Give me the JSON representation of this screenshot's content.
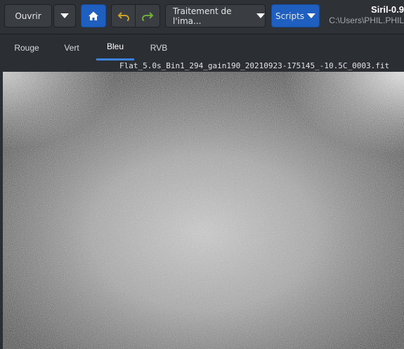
{
  "toolbar": {
    "open_label": "Ouvrir",
    "processing_label": "Traitement de l'ima...",
    "scripts_label": "Scripts",
    "app_title": "Siril-0.9",
    "path": "C:\\Users\\PHIL.PHIL"
  },
  "tabs": [
    {
      "label": "Rouge",
      "active": false
    },
    {
      "label": "Vert",
      "active": false
    },
    {
      "label": "Bleu",
      "active": true
    },
    {
      "label": "RVB",
      "active": false
    }
  ],
  "image": {
    "filename": "Flat_5.0s_Bin1_294_gain190_20210923-175145_-10.5C_0003.fit"
  },
  "colors": {
    "accent": "#1f5fbf",
    "tab_underline": "#3c82dc",
    "undo_arrow": "#c9a227",
    "redo_arrow": "#6fae3a"
  }
}
